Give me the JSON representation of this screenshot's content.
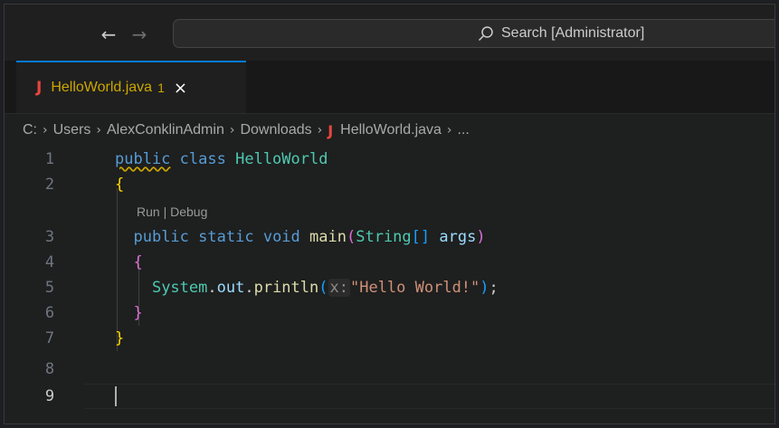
{
  "titlebar": {
    "back_arrow": "←",
    "forward_arrow": "→",
    "search_label": "Search [Administrator]"
  },
  "tab": {
    "icon": "J",
    "name": "HelloWorld.java",
    "badge": "1",
    "close": "×"
  },
  "breadcrumb": {
    "items": [
      "C:",
      "Users",
      "AlexConklinAdmin",
      "Downloads",
      "HelloWorld.java",
      "..."
    ],
    "separator": "›",
    "file_icon": "J"
  },
  "editor": {
    "line_numbers": [
      "1",
      "2",
      "3",
      "4",
      "5",
      "6",
      "7",
      "8",
      "9"
    ],
    "active_line": "9",
    "codelens": {
      "run": "Run",
      "divider": " | ",
      "debug": "Debug"
    },
    "lines": {
      "l1": {
        "kw_public": "public",
        "kw_class": "class",
        "name": "HelloWorld"
      },
      "l2": {
        "brace": "{"
      },
      "l3": {
        "kw_public": "public",
        "kw_static": "static",
        "kw_void": "void",
        "method": "main",
        "paren_open": "(",
        "type": "String",
        "brackets": "[]",
        "param": "args",
        "paren_close": ")"
      },
      "l4": {
        "brace": "{"
      },
      "l5": {
        "cls": "System",
        "dot1": ".",
        "field": "out",
        "dot2": ".",
        "method": "println",
        "paren_open": "(",
        "hint": "x:",
        "string": "\"Hello World!\"",
        "paren_close": ")",
        "semi": ";"
      },
      "l6": {
        "brace": "}"
      },
      "l7": {
        "brace": "}"
      }
    }
  },
  "colors": {
    "accent": "#0078d4",
    "java_icon": "#e8463d",
    "warning": "#cca700"
  }
}
